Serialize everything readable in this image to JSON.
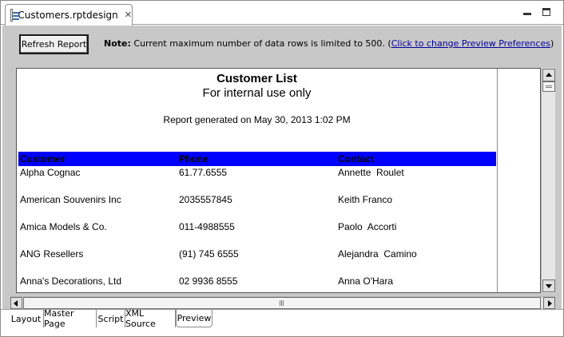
{
  "editor": {
    "tab_title": "Customers.rptdesign",
    "tab_icon": "report-file-icon",
    "close_icon": "close-icon"
  },
  "toolbar": {
    "refresh_label": "Refresh Report",
    "note_bold": "Note:",
    "note_text": " Current maximum number of data rows is limited to 500. (",
    "note_link": "Click to change Preview Preferences",
    "note_end": ")"
  },
  "report": {
    "title": "Customer List",
    "subtitle": "For internal use only",
    "generated": "Report generated on May 30, 2013 1:02 PM",
    "header_color": "#0000ff",
    "columns": [
      "Customer",
      "Phone",
      "Contact"
    ],
    "rows": [
      [
        "Alpha Cognac",
        "61.77.6555",
        "Annette  Roulet"
      ],
      [
        "American Souvenirs Inc",
        "2035557845",
        "Keith Franco"
      ],
      [
        "Amica Models & Co.",
        "011-4988555",
        "Paolo  Accorti"
      ],
      [
        "ANG Resellers",
        "(91) 745 6555",
        "Alejandra  Camino"
      ],
      [
        "Anna's Decorations, Ltd",
        "02 9936 8555",
        "Anna O'Hara"
      ]
    ]
  },
  "bottom_tabs": [
    "Layout",
    "Master Page",
    "Script",
    "XML Source",
    "Preview"
  ],
  "active_tab": "Preview"
}
